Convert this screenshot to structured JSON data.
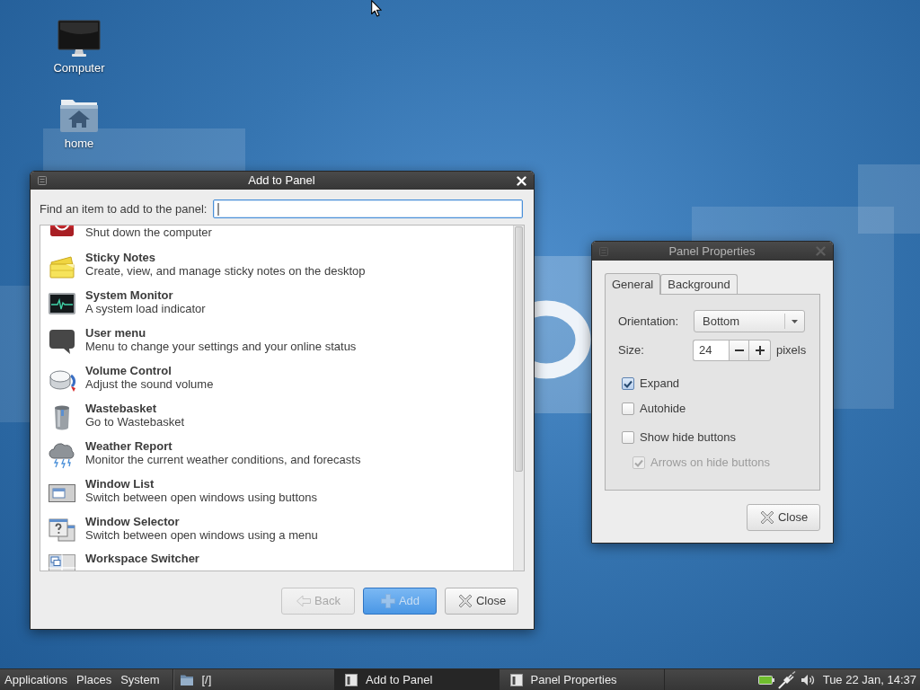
{
  "desktop": {
    "icons": [
      {
        "label": "Computer",
        "kind": "computer"
      },
      {
        "label": "home",
        "kind": "home"
      }
    ]
  },
  "add_to_panel": {
    "title": "Add to Panel",
    "active": true,
    "search": {
      "label": "Find an item to add to the panel:",
      "focused": true
    },
    "items": [
      {
        "description": "Shut down the computer",
        "kind": "power"
      },
      {
        "title": "Sticky Notes",
        "description": "Create, view, and manage sticky notes on the desktop",
        "kind": "notes"
      },
      {
        "title": "System Monitor",
        "description": "A system load indicator",
        "kind": "monitor"
      },
      {
        "title": "User menu",
        "description": "Menu to change your settings and your online status",
        "kind": "bubble"
      },
      {
        "title": "Volume Control",
        "description": "Adjust the sound volume",
        "kind": "knob"
      },
      {
        "title": "Wastebasket",
        "description": "Go to Wastebasket",
        "kind": "trash"
      },
      {
        "title": "Weather Report",
        "description": "Monitor the current weather conditions, and forecasts",
        "kind": "weather"
      },
      {
        "title": "Window List",
        "description": "Switch between open windows using buttons",
        "kind": "windowlist"
      },
      {
        "title": "Window Selector",
        "description": "Switch between open windows using a menu",
        "kind": "selector"
      },
      {
        "title": "Workspace Switcher",
        "kind": "workspaces"
      }
    ],
    "buttons": [
      {
        "label": "Back",
        "kind": "back",
        "disabled": true,
        "default": false
      },
      {
        "label": "Add",
        "kind": "add",
        "disabled": true,
        "default": true
      },
      {
        "label": "Close",
        "kind": "close",
        "disabled": false,
        "default": false
      }
    ]
  },
  "panel_properties": {
    "title": "Panel Properties",
    "active": false,
    "tabs": [
      {
        "label": "General",
        "selected": true
      },
      {
        "label": "Background",
        "selected": false
      }
    ],
    "orientation": {
      "label": "Orientation:",
      "value": "Bottom"
    },
    "size": {
      "label": "Size:",
      "value": "24",
      "unit": "pixels"
    },
    "options": [
      {
        "label": "Expand",
        "checked": true,
        "disabled": false
      },
      {
        "label": "Autohide",
        "checked": false,
        "disabled": false
      },
      {
        "label": "Show hide buttons",
        "checked": false,
        "disabled": false,
        "children": [
          {
            "label": "Arrows on hide buttons",
            "checked": true,
            "disabled": true
          }
        ]
      }
    ],
    "buttons": [
      {
        "label": "Close",
        "kind": "close",
        "disabled": false,
        "default": false
      }
    ]
  },
  "taskbar": {
    "menus": [
      "Applications",
      "Places",
      "System"
    ],
    "launcher": "[/]",
    "tasks": [
      {
        "label": "Add to Panel",
        "selected": true
      },
      {
        "label": "Panel Properties",
        "selected": false
      }
    ],
    "clock": "Tue 22 Jan, 14:37"
  }
}
